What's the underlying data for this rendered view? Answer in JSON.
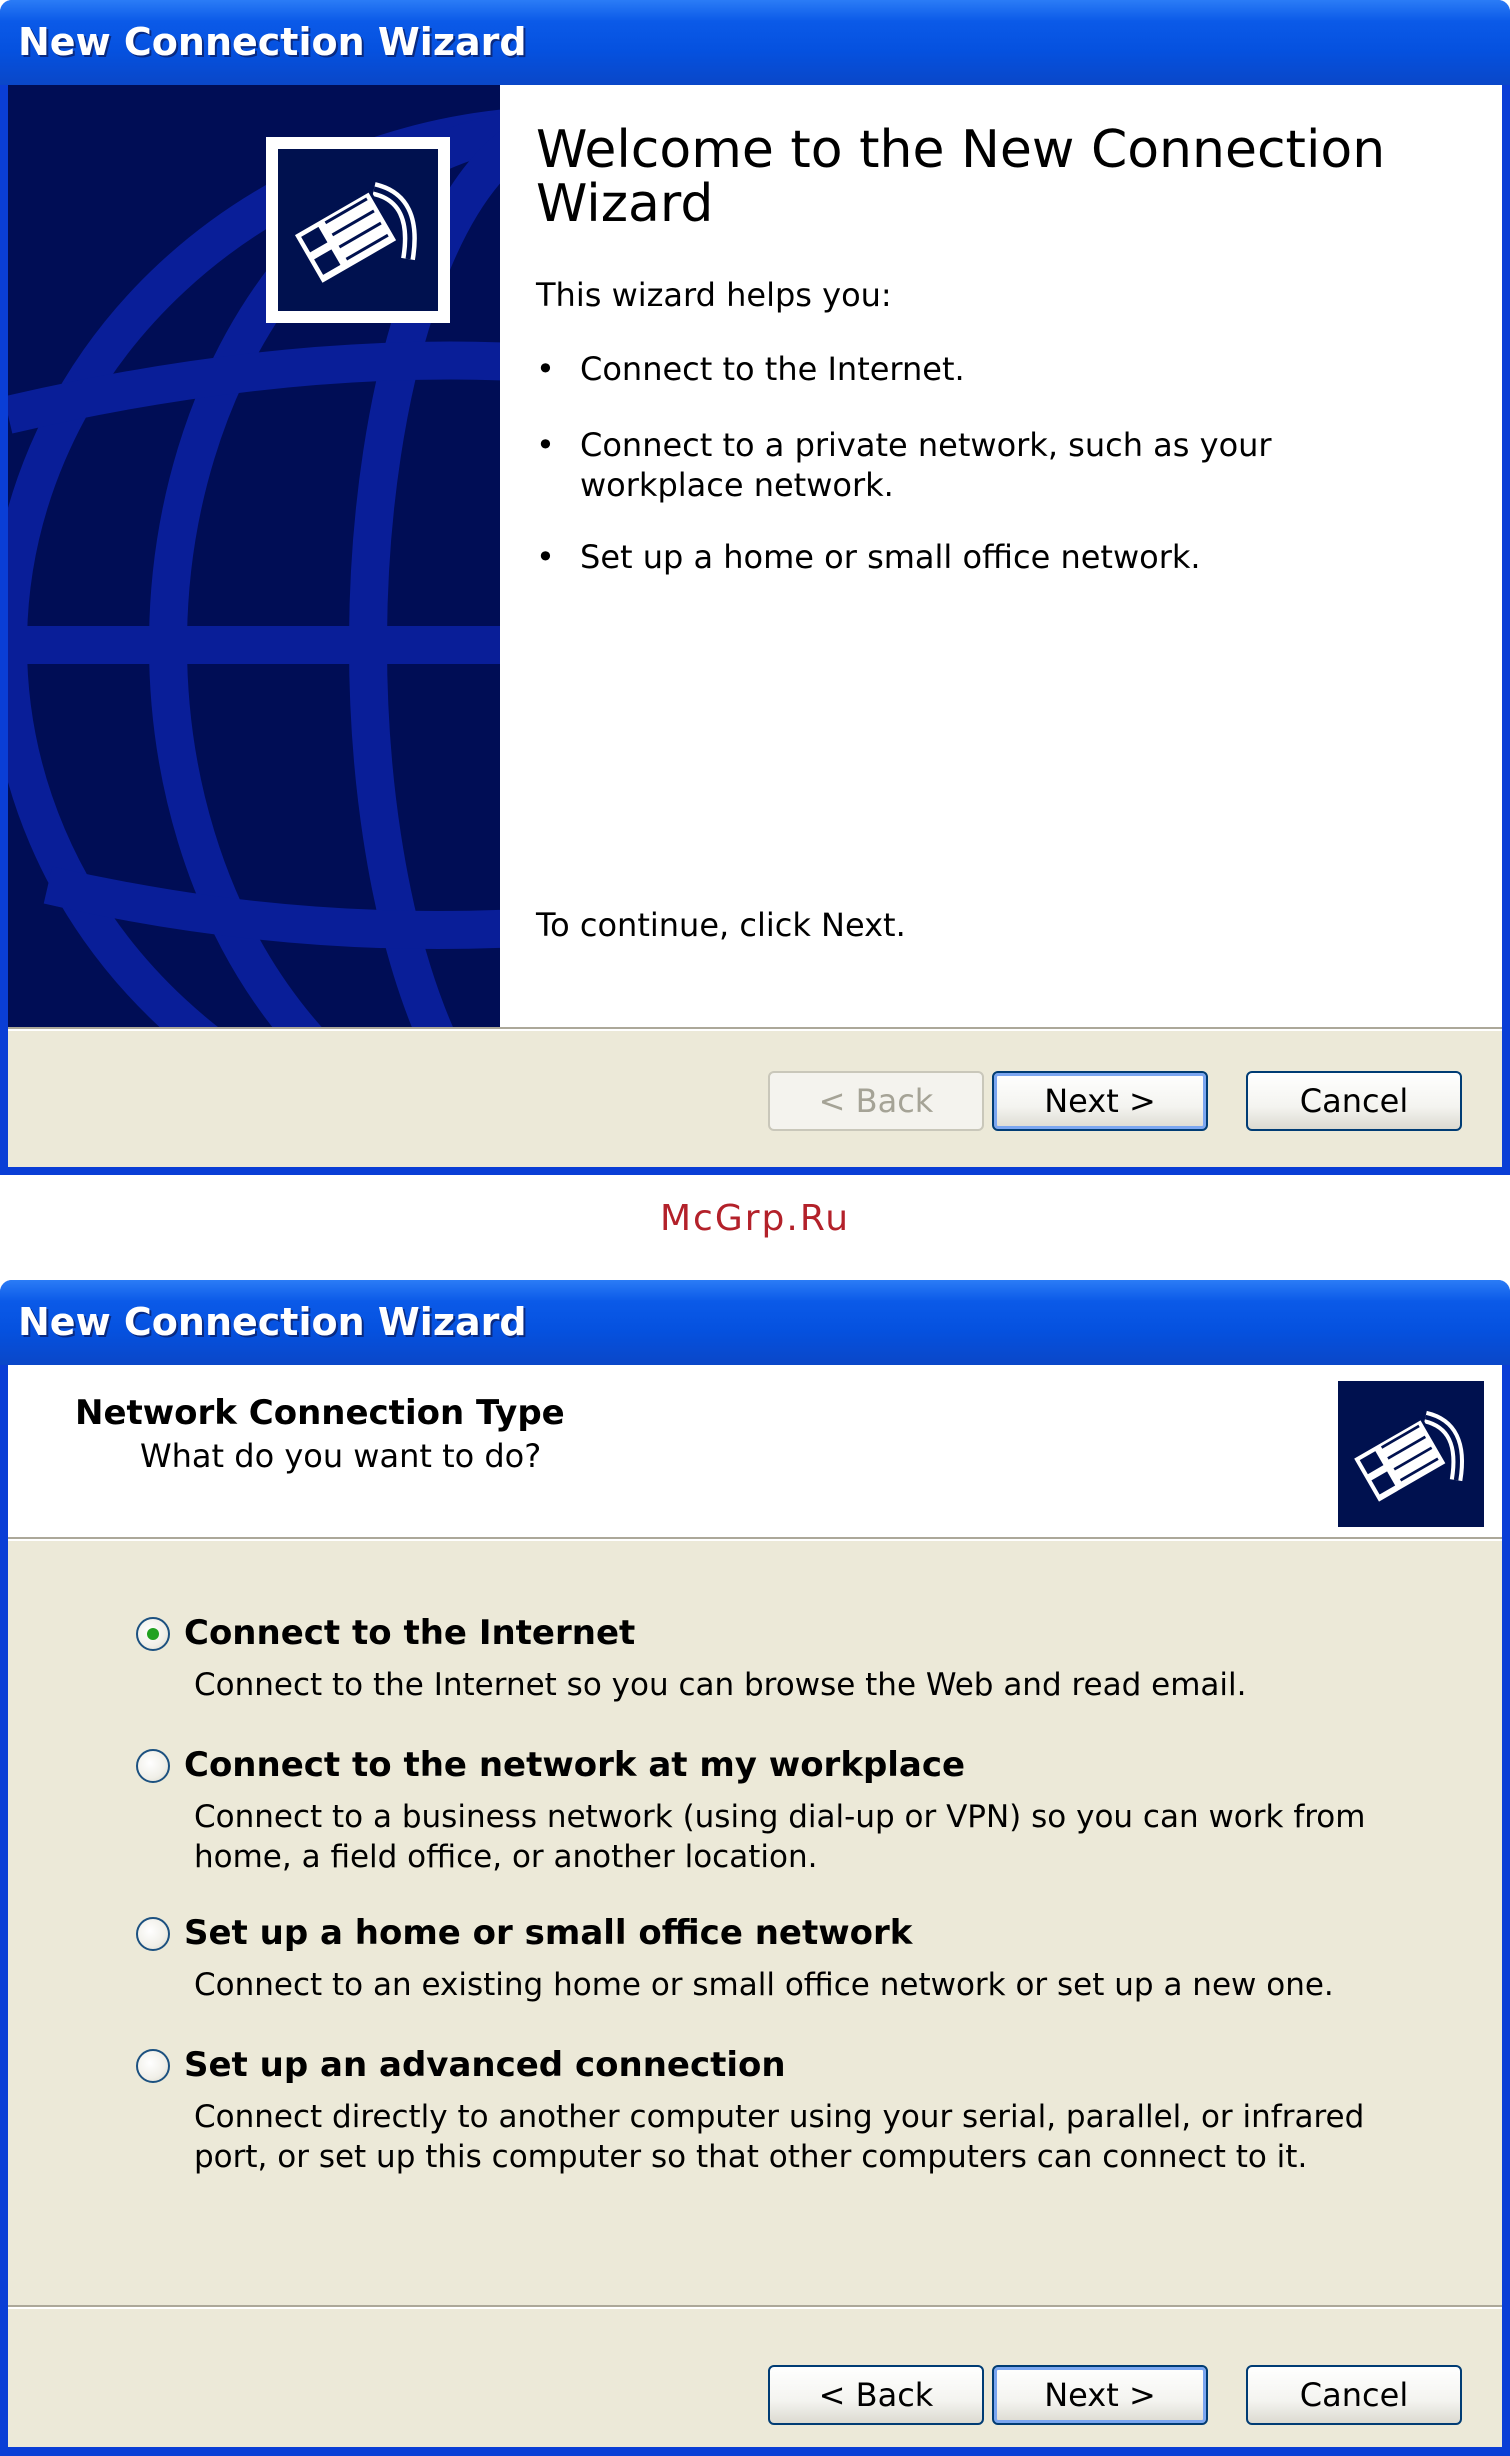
{
  "welcome_window": {
    "title": "New Connection Wizard",
    "heading": "Welcome to the New Connection Wizard",
    "intro": "This wizard helps you:",
    "bullets": [
      "Connect to the Internet.",
      "Connect to a private network, such as your workplace network.",
      "Set up a home or small office network."
    ],
    "continue_text": "To continue, click Next.",
    "buttons": {
      "back": "< Back",
      "next": "Next >",
      "cancel": "Cancel"
    }
  },
  "watermark": "McGrp.Ru",
  "type_window": {
    "title": "New Connection Wizard",
    "header_title": "Network Connection Type",
    "header_subtitle": "What do you want to do?",
    "options": [
      {
        "label": "Connect to the Internet",
        "description": "Connect to the Internet so you can browse the Web and read email.",
        "selected": true
      },
      {
        "label": "Connect to the network at my workplace",
        "description": "Connect to a business network (using dial-up or VPN) so you can work from home, a field office, or another location.",
        "selected": false
      },
      {
        "label": "Set up a home or small office network",
        "description": "Connect to an existing home or small office network or set up a new one.",
        "selected": false
      },
      {
        "label": "Set up an advanced connection",
        "description": "Connect directly to another computer using your serial, parallel, or infrared port, or set up this computer so that other computers can connect to it.",
        "selected": false
      }
    ],
    "buttons": {
      "back": "< Back",
      "next": "Next >",
      "cancel": "Cancel"
    }
  },
  "icons": {
    "wizard_logo": "network-cable-plug-icon",
    "radio_selected": "radio-checked-icon"
  },
  "colors": {
    "title_bar": "#0b5ae8",
    "side_panel": "#000d55",
    "dialog_face": "#ece9d8",
    "watermark": "#b3212a"
  }
}
